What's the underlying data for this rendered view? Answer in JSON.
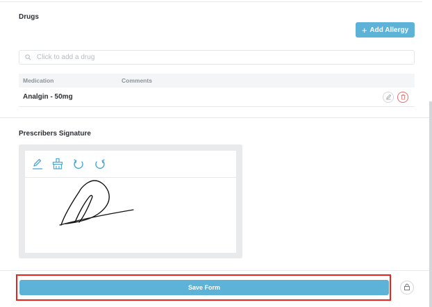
{
  "drugs": {
    "title": "Drugs",
    "add_allergy_label": "Add Allergy",
    "search_placeholder": "Click to add a drug",
    "columns": {
      "medication": "Medication",
      "comments": "Comments"
    },
    "rows": [
      {
        "medication": "Analgin - 50mg",
        "comments": ""
      }
    ]
  },
  "signature": {
    "title": "Prescribers Signature",
    "tools": [
      "pen-icon",
      "brush-icon",
      "undo-icon",
      "redo-icon"
    ]
  },
  "footer": {
    "save_label": "Save Form",
    "lock_icon": "lock-icon"
  },
  "colors": {
    "accent": "#5db2d8",
    "danger": "#e56b6b",
    "highlight": "#e8231b"
  }
}
